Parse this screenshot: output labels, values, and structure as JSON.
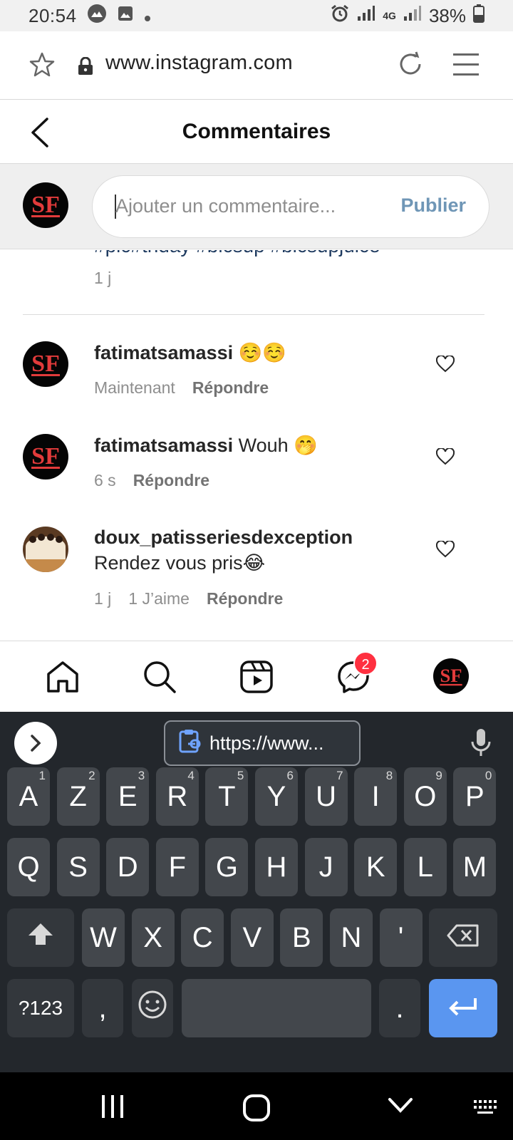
{
  "status_bar": {
    "time": "20:54",
    "network": "4G",
    "battery": "38%"
  },
  "browser": {
    "url": "www.instagram.com"
  },
  "header": {
    "title": "Commentaires"
  },
  "compose": {
    "placeholder": "Ajouter un commentaire...",
    "publish_label": "Publier"
  },
  "previous_post": {
    "hashtags_partial": "#pic#thday #bicsup #bicsupjuice",
    "time": "1 j"
  },
  "comments": [
    {
      "username": "fatimatsamassi",
      "text": "☺️☺️",
      "time": "Maintenant",
      "likes": "",
      "reply_label": "Répondre"
    },
    {
      "username": "fatimatsamassi",
      "text": "Wouh 🤭",
      "time": "6 s",
      "likes": "",
      "reply_label": "Répondre"
    },
    {
      "username": "doux_patisseriesdexception",
      "text": "Rendez vous pris😂",
      "time": "1 j",
      "likes": "1 J’aime",
      "reply_label": "Répondre"
    }
  ],
  "nav": {
    "messages_badge": "2"
  },
  "keyboard": {
    "clipboard_text": "https://www...",
    "row1": [
      {
        "k": "A",
        "h": "1"
      },
      {
        "k": "Z",
        "h": "2"
      },
      {
        "k": "E",
        "h": "3"
      },
      {
        "k": "R",
        "h": "4"
      },
      {
        "k": "T",
        "h": "5"
      },
      {
        "k": "Y",
        "h": "6"
      },
      {
        "k": "U",
        "h": "7"
      },
      {
        "k": "I",
        "h": "8"
      },
      {
        "k": "O",
        "h": "9"
      },
      {
        "k": "P",
        "h": "0"
      }
    ],
    "row2": [
      "Q",
      "S",
      "D",
      "F",
      "G",
      "H",
      "J",
      "K",
      "L",
      "M"
    ],
    "row3": [
      "W",
      "X",
      "C",
      "V",
      "B",
      "N",
      "'"
    ],
    "symbols_label": "?123",
    "comma": ",",
    "period": "."
  },
  "colors": {
    "accent_publish": "#6f96b6",
    "badge": "#ff3040",
    "enter_key": "#5a96f0",
    "keyboard_bg": "#23272c"
  }
}
